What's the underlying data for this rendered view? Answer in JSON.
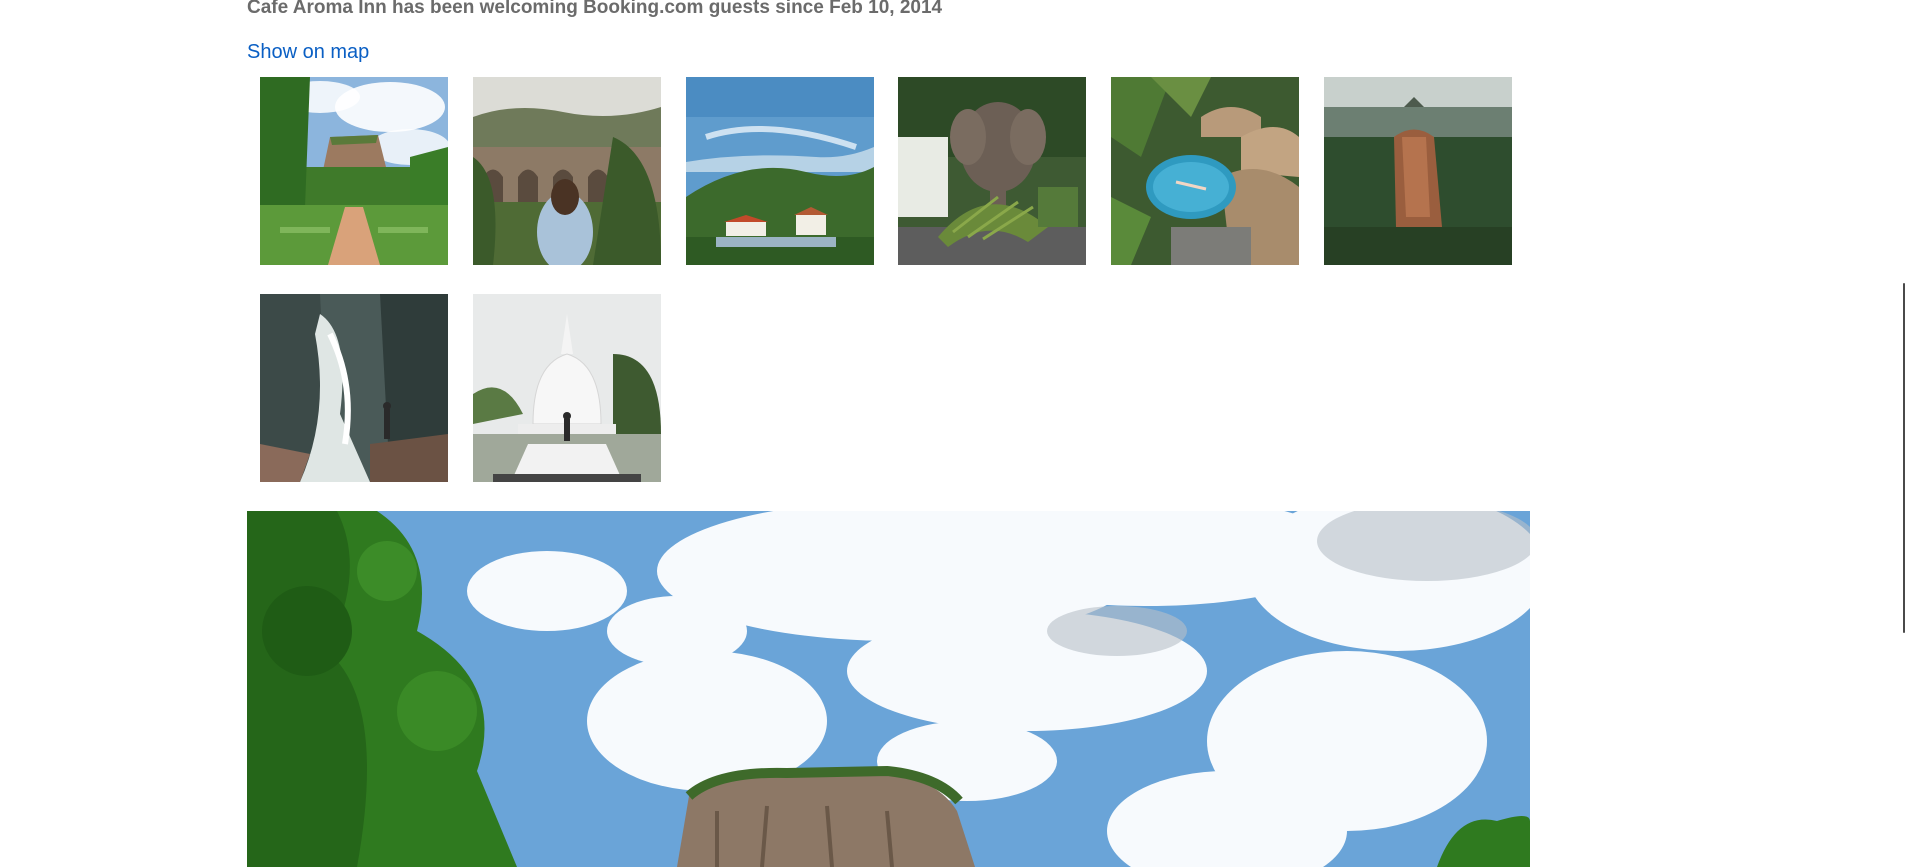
{
  "property": {
    "since_text": "Cafe Aroma Inn has been welcoming Booking.com guests since Feb 10, 2014",
    "map_link_label": "Show on map"
  },
  "gallery": {
    "photos": [
      {
        "subject": "sigiriya-rock-gardens"
      },
      {
        "subject": "nine-arch-bridge"
      },
      {
        "subject": "kandy-lake-view"
      },
      {
        "subject": "elephant-eating-palm"
      },
      {
        "subject": "jungle-pool-villas"
      },
      {
        "subject": "sigiriya-aerial-forest"
      },
      {
        "subject": "waterfall-hiker"
      },
      {
        "subject": "white-stupa"
      }
    ]
  },
  "hero_photo": {
    "subject": "sigiriya-rock-sky"
  },
  "colors": {
    "link": "#0a5fc4",
    "muted_text": "#6b6b6b"
  }
}
